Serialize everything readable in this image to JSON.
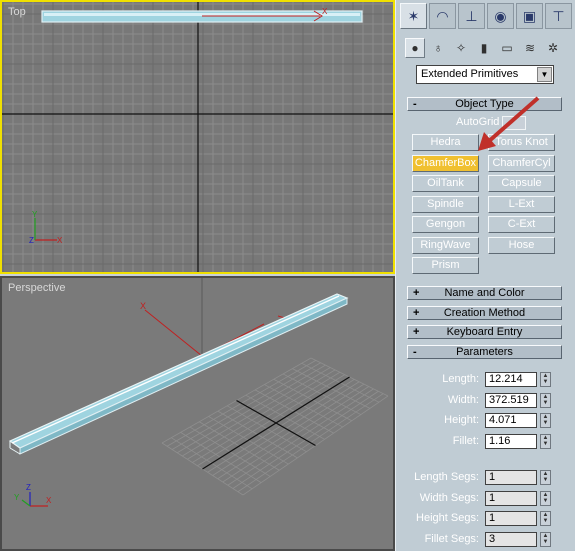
{
  "viewports": {
    "top_label": "Top",
    "perspective_label": "Perspective"
  },
  "panel": {
    "tabs": [
      {
        "icon": "wand-icon",
        "active": true
      },
      {
        "icon": "curve-icon"
      },
      {
        "icon": "hierarchy-icon"
      },
      {
        "icon": "motion-icon"
      },
      {
        "icon": "display-icon"
      },
      {
        "icon": "hammer-icon"
      }
    ],
    "subtabs": [
      {
        "icon": "sphere-icon",
        "active": true
      },
      {
        "icon": "shapes-icon"
      },
      {
        "icon": "lights-icon"
      },
      {
        "icon": "camera-icon"
      },
      {
        "icon": "helpers-icon"
      },
      {
        "icon": "spacewarps-icon"
      },
      {
        "icon": "systems-icon"
      }
    ],
    "category": "Extended Primitives",
    "object_type": {
      "title": "Object Type",
      "sign": "-",
      "autogrid": "AutoGrid",
      "buttons": [
        "Hedra",
        "Torus Knot",
        "ChamferBox",
        "ChamferCyl",
        "OilTank",
        "Capsule",
        "Spindle",
        "L-Ext",
        "Gengon",
        "C-Ext",
        "RingWave",
        "Hose",
        "Prism"
      ],
      "selected": "ChamferBox"
    },
    "rollouts": [
      {
        "sign": "+",
        "title": "Name and Color"
      },
      {
        "sign": "+",
        "title": "Creation Method"
      },
      {
        "sign": "+",
        "title": "Keyboard Entry"
      },
      {
        "sign": "-",
        "title": "Parameters"
      }
    ],
    "parameters": [
      {
        "label": "Length:",
        "value": "12.214"
      },
      {
        "label": "Width:",
        "value": "372.519"
      },
      {
        "label": "Height:",
        "value": "4.071"
      },
      {
        "label": "Fillet:",
        "value": "1.16"
      }
    ],
    "segments": [
      {
        "label": "Length Segs:",
        "value": "1"
      },
      {
        "label": "Width Segs:",
        "value": "1"
      },
      {
        "label": "Height Segs:",
        "value": "1"
      },
      {
        "label": "Fillet Segs:",
        "value": "3"
      }
    ]
  },
  "axis_labels": {
    "x": "X",
    "y": "Y",
    "z": "Z"
  },
  "colors": {
    "active_viewport_border": "#f0e000",
    "selected_button": "#f0c030",
    "annotation_arrow": "#c0302a",
    "object_fill": "#9fd4e0"
  }
}
